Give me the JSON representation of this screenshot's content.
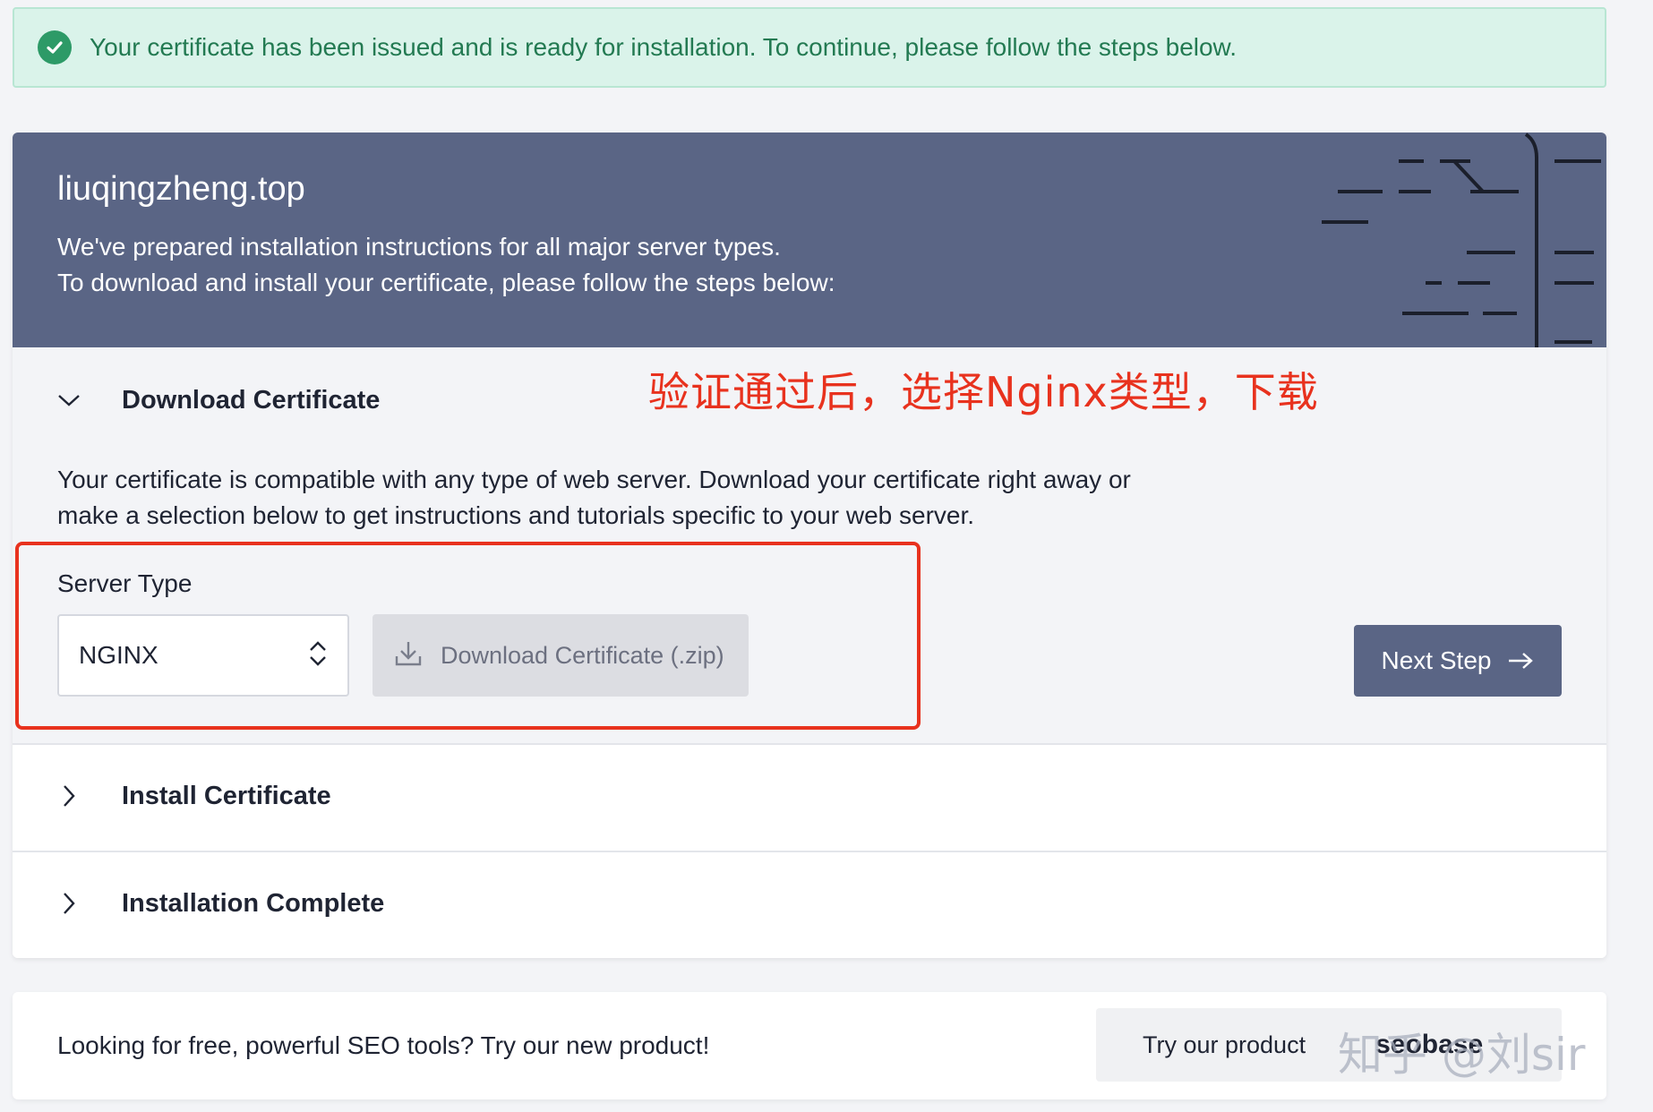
{
  "alert": {
    "message": "Your certificate has been issued and is ready for installation. To continue, please follow the steps below.",
    "icon": "check-circle-icon",
    "color": "#237a52"
  },
  "hero": {
    "domain": "liuqingzheng.top",
    "line1": "We've prepared installation instructions for all major server types.",
    "line2": "To download and install your certificate, please follow the steps below:",
    "background": "#5a6585"
  },
  "annotation": "验证通过后，选择Nginx类型，下载",
  "steps": [
    {
      "title": "Download Certificate",
      "expanded": true,
      "description": "Your certificate is compatible with any type of web server. Download your certificate right away or make a selection below to get instructions and tutorials specific to your web server.",
      "server_type_label": "Server Type",
      "server_type_value": "NGINX",
      "download_label": "Download Certificate (.zip)",
      "next_label": "Next Step"
    },
    {
      "title": "Install Certificate",
      "expanded": false
    },
    {
      "title": "Installation Complete",
      "expanded": false
    }
  ],
  "promo": {
    "text": "Looking for free, powerful SEO tools? Try our new product!",
    "button_label": "Try our product",
    "brand": "seobase"
  },
  "watermark": "知乎 @刘sir"
}
